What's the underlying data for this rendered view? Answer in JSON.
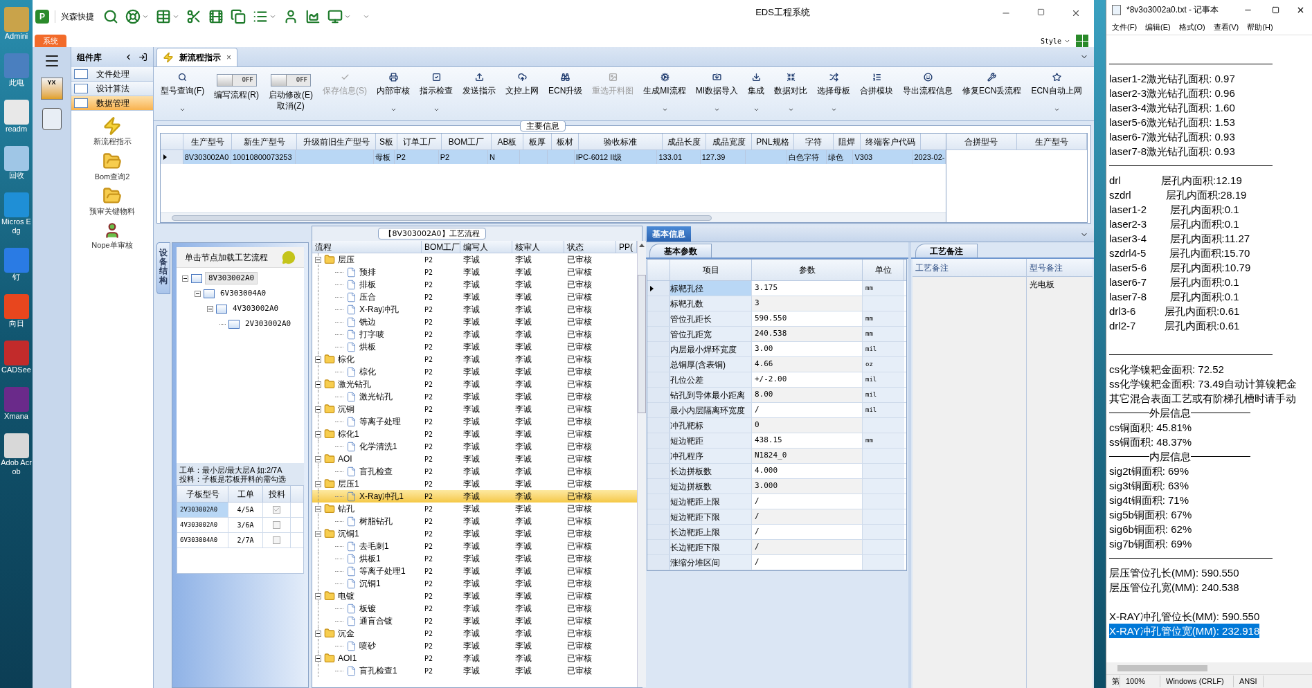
{
  "desktop": {
    "icons": [
      {
        "label": "Admini"
      },
      {
        "label": "此电"
      },
      {
        "label": "readm"
      },
      {
        "label": "回收"
      },
      {
        "label": "Micros Edg"
      },
      {
        "label": "钉"
      },
      {
        "label": "向日"
      },
      {
        "label": "CADSee"
      },
      {
        "label": "Xmana"
      },
      {
        "label": "Adob Acrob"
      }
    ]
  },
  "window": {
    "title": "EDS工程系统",
    "logo_text": "P",
    "nav_badge": "YX",
    "app_name": "兴森快捷",
    "quick_tools": [
      {
        "dropdown": false
      },
      {
        "dropdown": true
      },
      {
        "dropdown": true
      },
      {
        "dropdown": false
      },
      {
        "dropdown": false
      },
      {
        "dropdown": false
      },
      {
        "dropdown": true
      },
      {
        "dropdown": false
      },
      {
        "dropdown": false
      },
      {
        "dropdown": true
      }
    ],
    "menu_tab": "系统",
    "style_label": "Style"
  },
  "component_library": {
    "title": "组件库",
    "sections": [
      {
        "label": "文件处理",
        "selected": false
      },
      {
        "label": "设计算法",
        "selected": false
      },
      {
        "label": "数据管理",
        "selected": true
      }
    ],
    "items": [
      {
        "label": "新流程指示"
      },
      {
        "label": "Bom查询2"
      },
      {
        "label": "预审关键物料"
      },
      {
        "label": "Nope单审核"
      }
    ]
  },
  "doc_tab": {
    "label": "新流程指示",
    "close": "×"
  },
  "ribbon": [
    {
      "kind": "button",
      "label": "型号查询(F)",
      "dropdown": true,
      "disabled": false
    },
    {
      "kind": "toggle",
      "label": "编写流程(R)",
      "state_text": "OFF",
      "on": false
    },
    {
      "kind": "toggle",
      "label": "启动修改(E)\n取消(Z)",
      "state_text": "OFF",
      "on": false
    },
    {
      "kind": "button",
      "label": "保存信息(S)",
      "dropdown": false,
      "disabled": true
    },
    {
      "kind": "button",
      "label": "内部审核",
      "dropdown": true,
      "disabled": false
    },
    {
      "kind": "button",
      "label": "指示检查",
      "dropdown": true,
      "disabled": false
    },
    {
      "kind": "button",
      "label": "发送指示",
      "dropdown": false,
      "disabled": false
    },
    {
      "kind": "button",
      "label": "文控上网",
      "dropdown": false,
      "disabled": false
    },
    {
      "kind": "button",
      "label": "ECN升级",
      "dropdown": false,
      "disabled": false
    },
    {
      "kind": "button",
      "label": "重选开料图",
      "dropdown": false,
      "disabled": true
    },
    {
      "kind": "button",
      "label": "生成MI流程",
      "dropdown": true,
      "disabled": false
    },
    {
      "kind": "button",
      "label": "MI数据导入",
      "dropdown": true,
      "disabled": false
    },
    {
      "kind": "button",
      "label": "集成",
      "dropdown": true,
      "disabled": false
    },
    {
      "kind": "button",
      "label": "数据对比",
      "dropdown": true,
      "disabled": false
    },
    {
      "kind": "button",
      "label": "选择母板",
      "dropdown": true,
      "disabled": false
    },
    {
      "kind": "button",
      "label": "合拼模块",
      "dropdown": false,
      "disabled": false
    },
    {
      "kind": "button",
      "label": "导出流程信息",
      "dropdown": false,
      "disabled": false
    },
    {
      "kind": "button",
      "label": "修复ECN丢流程",
      "dropdown": false,
      "disabled": false
    },
    {
      "kind": "button",
      "label": "ECN自动上网",
      "dropdown": true,
      "disabled": false
    }
  ],
  "main_info": {
    "title": "主要信息",
    "columns": [
      "生产型号",
      "新生产型号",
      "升级前旧生产型号",
      "S板",
      "订单工厂",
      "BOM工厂",
      "AB板",
      "板厚",
      "板材",
      "验收标准",
      "成品长度",
      "成品宽度",
      "PNL规格",
      "字符",
      "阻焊",
      "终端客户代码"
    ],
    "rows": [
      {
        "selected": true,
        "cells": [
          "8V303002A0",
          "10010800073253",
          "",
          "母板",
          "P2",
          "P2",
          "N",
          "",
          "",
          "IPC-6012 II级",
          "133.01",
          "127.39",
          "",
          "白色字符",
          "绿色",
          "V303",
          "2023-02-"
        ]
      }
    ],
    "merge_columns": [
      "合拼型号",
      "生产型号"
    ]
  },
  "structure": {
    "side_tab": "设备结构",
    "hint": "单击节点加载工艺流程",
    "tree": [
      {
        "label": "8V303002A0",
        "expanded": true,
        "selected": true,
        "children": [
          {
            "label": "6V303004A0",
            "expanded": true,
            "selected": false,
            "children": [
              {
                "label": "4V303002A0",
                "expanded": true,
                "selected": false,
                "children": [
                  {
                    "label": "2V303002A0",
                    "selected": false
                  }
                ]
              }
            ]
          }
        ]
      }
    ],
    "note": [
      "工单：最小层/最大层A 如:2/7A",
      "投料：子板是芯板开料的需勾选"
    ],
    "columns": [
      "子板型号",
      "工单",
      "投料"
    ],
    "rows": [
      {
        "model": "2V303002A0",
        "order": "4/5A",
        "checked": true,
        "selected": true
      },
      {
        "model": "4V303002A0",
        "order": "3/6A",
        "checked": false,
        "selected": false
      },
      {
        "model": "6V303004A0",
        "order": "2/7A",
        "checked": false,
        "selected": false
      }
    ]
  },
  "process": {
    "title": "【8V303002A0】工艺流程",
    "columns": [
      "流程",
      "BOM工厂",
      "编写人",
      "核审人",
      "状态",
      "PP("
    ],
    "nodes": [
      {
        "name": "层压",
        "bom": "P2",
        "writer": "李诚",
        "reviewer": "李诚",
        "status": "已审核",
        "expanded": true,
        "selected": false,
        "children": [
          {
            "name": "预排",
            "bom": "P2",
            "writer": "李诚",
            "reviewer": "李诚",
            "status": "已审核",
            "selected": false
          },
          {
            "name": "排板",
            "bom": "P2",
            "writer": "李诚",
            "reviewer": "李诚",
            "status": "已审核",
            "selected": false
          },
          {
            "name": "压合",
            "bom": "P2",
            "writer": "李诚",
            "reviewer": "李诚",
            "status": "已审核",
            "selected": false
          },
          {
            "name": "X-Ray冲孔",
            "bom": "P2",
            "writer": "李诚",
            "reviewer": "李诚",
            "status": "已审核",
            "selected": false
          },
          {
            "name": "铣边",
            "bom": "P2",
            "writer": "李诚",
            "reviewer": "李诚",
            "status": "已审核",
            "selected": false
          },
          {
            "name": "打字唛",
            "bom": "P2",
            "writer": "李诚",
            "reviewer": "李诚",
            "status": "已审核",
            "selected": false
          },
          {
            "name": "烘板",
            "bom": "P2",
            "writer": "李诚",
            "reviewer": "李诚",
            "status": "已审核",
            "selected": false
          }
        ]
      },
      {
        "name": "棕化",
        "bom": "P2",
        "writer": "李诚",
        "reviewer": "李诚",
        "status": "已审核",
        "expanded": true,
        "selected": false,
        "children": [
          {
            "name": "棕化",
            "bom": "P2",
            "writer": "李诚",
            "reviewer": "李诚",
            "status": "已审核",
            "selected": false
          }
        ]
      },
      {
        "name": "激光钻孔",
        "bom": "P2",
        "writer": "李诚",
        "reviewer": "李诚",
        "status": "已审核",
        "expanded": true,
        "selected": false,
        "children": [
          {
            "name": "激光钻孔",
            "bom": "P2",
            "writer": "李诚",
            "reviewer": "李诚",
            "status": "已审核",
            "selected": false
          }
        ]
      },
      {
        "name": "沉铜",
        "bom": "P2",
        "writer": "李诚",
        "reviewer": "李诚",
        "status": "已审核",
        "expanded": true,
        "selected": false,
        "children": [
          {
            "name": "等离子处理",
            "bom": "P2",
            "writer": "李诚",
            "reviewer": "李诚",
            "status": "已审核",
            "selected": false
          }
        ]
      },
      {
        "name": "棕化1",
        "bom": "P2",
        "writer": "李诚",
        "reviewer": "李诚",
        "status": "已审核",
        "expanded": true,
        "selected": false,
        "children": [
          {
            "name": "化学清洗1",
            "bom": "P2",
            "writer": "李诚",
            "reviewer": "李诚",
            "status": "已审核",
            "selected": false
          }
        ]
      },
      {
        "name": "AOI",
        "bom": "P2",
        "writer": "李诚",
        "reviewer": "李诚",
        "status": "已审核",
        "expanded": true,
        "selected": false,
        "children": [
          {
            "name": "盲孔检查",
            "bom": "P2",
            "writer": "李诚",
            "reviewer": "李诚",
            "status": "已审核",
            "selected": false
          }
        ]
      },
      {
        "name": "层压1",
        "bom": "P2",
        "writer": "李诚",
        "reviewer": "李诚",
        "status": "已审核",
        "expanded": true,
        "selected": false,
        "children": [
          {
            "name": "X-Ray冲孔1",
            "bom": "P2",
            "writer": "李诚",
            "reviewer": "李诚",
            "status": "已审核",
            "selected": true
          }
        ]
      },
      {
        "name": "钻孔",
        "bom": "P2",
        "writer": "李诚",
        "reviewer": "李诚",
        "status": "已审核",
        "expanded": true,
        "selected": false,
        "children": [
          {
            "name": "树脂钻孔",
            "bom": "P2",
            "writer": "李诚",
            "reviewer": "李诚",
            "status": "已审核",
            "selected": false
          }
        ]
      },
      {
        "name": "沉铜1",
        "bom": "P2",
        "writer": "李诚",
        "reviewer": "李诚",
        "status": "已审核",
        "expanded": true,
        "selected": false,
        "children": [
          {
            "name": "去毛刺1",
            "bom": "P2",
            "writer": "李诚",
            "reviewer": "李诚",
            "status": "已审核",
            "selected": false
          },
          {
            "name": "烘板1",
            "bom": "P2",
            "writer": "李诚",
            "reviewer": "李诚",
            "status": "已审核",
            "selected": false
          },
          {
            "name": "等离子处理1",
            "bom": "P2",
            "writer": "李诚",
            "reviewer": "李诚",
            "status": "已审核",
            "selected": false
          },
          {
            "name": "沉铜1",
            "bom": "P2",
            "writer": "李诚",
            "reviewer": "李诚",
            "status": "已审核",
            "selected": false
          }
        ]
      },
      {
        "name": "电镀",
        "bom": "P2",
        "writer": "李诚",
        "reviewer": "李诚",
        "status": "已审核",
        "expanded": true,
        "selected": false,
        "children": [
          {
            "name": "板镀",
            "bom": "P2",
            "writer": "李诚",
            "reviewer": "李诚",
            "status": "已审核",
            "selected": false
          },
          {
            "name": "通盲合镀",
            "bom": "P2",
            "writer": "李诚",
            "reviewer": "李诚",
            "status": "已审核",
            "selected": false
          }
        ]
      },
      {
        "name": "沉金",
        "bom": "P2",
        "writer": "李诚",
        "reviewer": "李诚",
        "status": "已审核",
        "expanded": true,
        "selected": false,
        "children": [
          {
            "name": "喷砂",
            "bom": "P2",
            "writer": "李诚",
            "reviewer": "李诚",
            "status": "已审核",
            "selected": false
          }
        ]
      },
      {
        "name": "AOI1",
        "bom": "P2",
        "writer": "李诚",
        "reviewer": "李诚",
        "status": "已审核",
        "expanded": true,
        "selected": false,
        "children": [
          {
            "name": "盲孔检查1",
            "bom": "P2",
            "writer": "李诚",
            "reviewer": "李诚",
            "status": "已审核",
            "selected": false
          }
        ]
      }
    ]
  },
  "basic_info": {
    "tab": "基本信息",
    "params_tab": "基本参数",
    "columns": [
      "项目",
      "参数",
      "单位"
    ],
    "rows": [
      {
        "item": "标靶孔径",
        "value": "3.175",
        "unit": "mm",
        "selected": true
      },
      {
        "item": "标靶孔数",
        "value": "3",
        "unit": "",
        "selected": false
      },
      {
        "item": "管位孔距长",
        "value": "590.550",
        "unit": "mm",
        "selected": false
      },
      {
        "item": "管位孔距宽",
        "value": "240.538",
        "unit": "mm",
        "selected": false
      },
      {
        "item": "内层最小焊环宽度",
        "value": "3.00",
        "unit": "mil",
        "selected": false
      },
      {
        "item": "总铜厚(含表铜)",
        "value": "4.66",
        "unit": "oz",
        "selected": false
      },
      {
        "item": "孔位公差",
        "value": "+/-2.00",
        "unit": "mil",
        "selected": false
      },
      {
        "item": "钻孔到导体最小距离",
        "value": "8.00",
        "unit": "mil",
        "selected": false
      },
      {
        "item": "最小内层隔离环宽度",
        "value": "/",
        "unit": "mil",
        "selected": false
      },
      {
        "item": "冲孔靶标",
        "value": "0",
        "unit": "",
        "selected": false
      },
      {
        "item": "短边靶距",
        "value": "438.15",
        "unit": "mm",
        "selected": false
      },
      {
        "item": "冲孔程序",
        "value": "N1824_0",
        "unit": "",
        "selected": false
      },
      {
        "item": "长边拼板数",
        "value": "4.000",
        "unit": "",
        "selected": false
      },
      {
        "item": "短边拼板数",
        "value": "3.000",
        "unit": "",
        "selected": false
      },
      {
        "item": "短边靶距上限",
        "value": "/",
        "unit": "",
        "selected": false
      },
      {
        "item": "短边靶距下限",
        "value": "/",
        "unit": "",
        "selected": false
      },
      {
        "item": "长边靶距上限",
        "value": "/",
        "unit": "",
        "selected": false
      },
      {
        "item": "长边靶距下限",
        "value": "/",
        "unit": "",
        "selected": false
      },
      {
        "item": "涨缩分堆区间",
        "value": "/",
        "unit": "",
        "selected": false
      }
    ],
    "remarks_tab": "工艺备注",
    "remark_columns": [
      "工艺备注",
      "型号备注"
    ],
    "model_remark": "光电板"
  },
  "notepad": {
    "title": "*8v3o3002a0.txt - 记事本",
    "menu": [
      "文件(F)",
      "编辑(E)",
      "格式(O)",
      "查看(V)",
      "帮助(H)"
    ],
    "lines": [
      {
        "kind": "blank",
        "selected": false
      },
      {
        "kind": "rule",
        "selected": false
      },
      {
        "kind": "text",
        "text": "laser1-2激光钻孔面积: 0.97",
        "selected": false
      },
      {
        "kind": "text",
        "text": "laser2-3激光钻孔面积: 0.96",
        "selected": false
      },
      {
        "kind": "text",
        "text": "laser3-4激光钻孔面积: 1.60",
        "selected": false
      },
      {
        "kind": "text",
        "text": "laser5-6激光钻孔面积: 1.53",
        "selected": false
      },
      {
        "kind": "text",
        "text": "laser6-7激光钻孔面积: 0.93",
        "selected": false
      },
      {
        "kind": "text",
        "text": "laser7-8激光钻孔面积: 0.93",
        "selected": false
      },
      {
        "kind": "rule",
        "selected": false
      },
      {
        "kind": "text",
        "text": "drl              层孔内面积:12.19",
        "selected": false
      },
      {
        "kind": "text",
        "text": "szdrl            层孔内面积:28.19",
        "selected": false
      },
      {
        "kind": "text",
        "text": "laser1-2        层孔内面积:0.1",
        "selected": false
      },
      {
        "kind": "text",
        "text": "laser2-3        层孔内面积:0.1",
        "selected": false
      },
      {
        "kind": "text",
        "text": "laser3-4        层孔内面积:11.27",
        "selected": false
      },
      {
        "kind": "text",
        "text": "szdrl4-5        层孔内面积:15.70",
        "selected": false
      },
      {
        "kind": "text",
        "text": "laser5-6        层孔内面积:10.79",
        "selected": false
      },
      {
        "kind": "text",
        "text": "laser6-7        层孔内面积:0.1",
        "selected": false
      },
      {
        "kind": "text",
        "text": "laser7-8        层孔内面积:0.1",
        "selected": false
      },
      {
        "kind": "text",
        "text": "drl3-6          层孔内面积:0.61",
        "selected": false
      },
      {
        "kind": "text",
        "text": "drl2-7          层孔内面积:0.61",
        "selected": false
      },
      {
        "kind": "blank",
        "selected": false
      },
      {
        "kind": "rule",
        "selected": false
      },
      {
        "kind": "text",
        "text": "cs化学镍耙金面积: 72.52",
        "selected": false
      },
      {
        "kind": "text",
        "text": "ss化学镍耙金面积: 73.49自动计算镍耙金",
        "selected": false
      },
      {
        "kind": "text",
        "text": "其它混合表面工艺或有阶梯孔槽时请手动",
        "selected": false
      },
      {
        "kind": "titled_rule",
        "text": "外层信息",
        "selected": false
      },
      {
        "kind": "text",
        "text": "cs铜面积: 45.81%",
        "selected": false
      },
      {
        "kind": "text",
        "text": "ss铜面积: 48.37%",
        "selected": false
      },
      {
        "kind": "titled_rule",
        "text": "内层信息",
        "selected": false
      },
      {
        "kind": "text",
        "text": "sig2t铜面积: 69%",
        "selected": false
      },
      {
        "kind": "text",
        "text": "sig3t铜面积: 63%",
        "selected": false
      },
      {
        "kind": "text",
        "text": "sig4t铜面积: 71%",
        "selected": false
      },
      {
        "kind": "text",
        "text": "sig5b铜面积: 67%",
        "selected": false
      },
      {
        "kind": "text",
        "text": "sig6b铜面积: 62%",
        "selected": false
      },
      {
        "kind": "text",
        "text": "sig7b铜面积: 69%",
        "selected": false
      },
      {
        "kind": "rule",
        "selected": false
      },
      {
        "kind": "text",
        "text": "层压管位孔长(MM): 590.550",
        "selected": false
      },
      {
        "kind": "text",
        "text": "层压管位孔宽(MM): 240.538",
        "selected": false
      },
      {
        "kind": "blank",
        "selected": false
      },
      {
        "kind": "text",
        "text": "X-RAY冲孔管位长(MM): 590.550",
        "selected": false
      },
      {
        "kind": "text",
        "text": "X-RAY冲孔管位宽(MM): 232.918",
        "selected": true
      }
    ],
    "status": [
      "第",
      "100%",
      "Windows (CRLF)",
      "ANSI"
    ]
  }
}
